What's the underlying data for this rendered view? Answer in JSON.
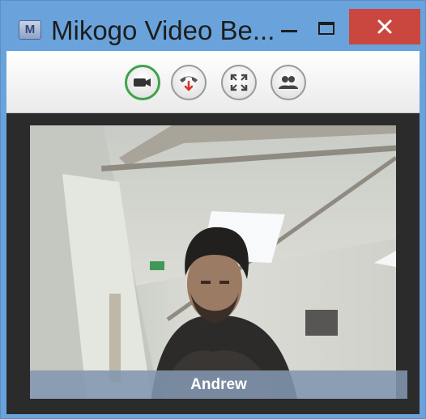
{
  "window": {
    "title": "Mikogo Video Be...",
    "accent": "#6aa3db",
    "close_color": "#c9473f"
  },
  "toolbar": {
    "buttons": [
      {
        "icon": "video-camera-icon",
        "active": true
      },
      {
        "icon": "hang-up-icon"
      },
      {
        "icon": "fullscreen-icon"
      },
      {
        "icon": "participants-icon"
      }
    ],
    "active_color": "#3fa24c"
  },
  "video": {
    "participant_name": "Andrew"
  }
}
